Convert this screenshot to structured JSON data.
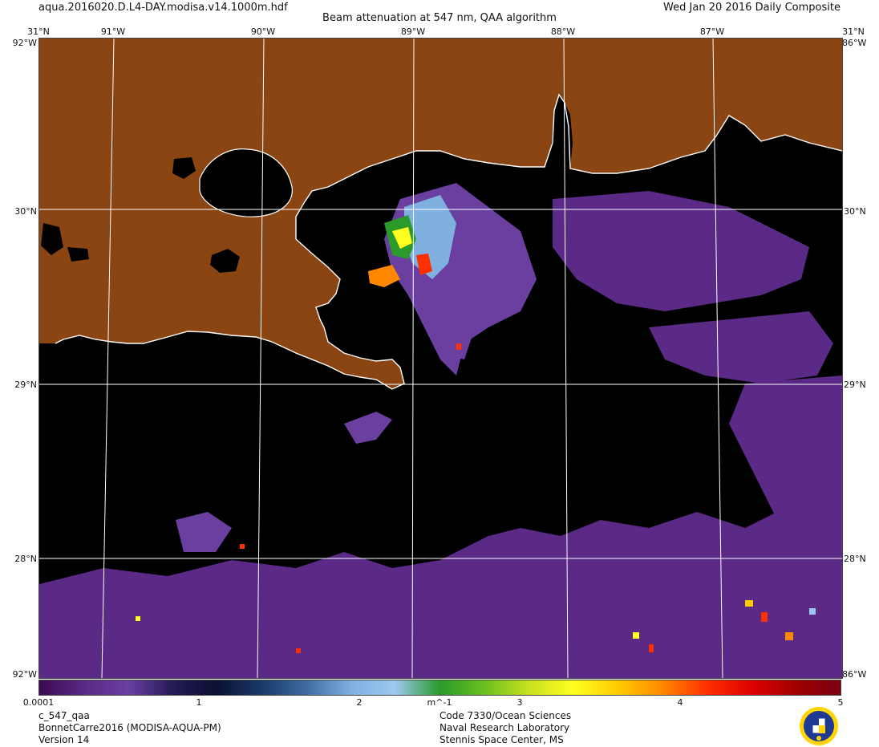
{
  "header": {
    "filename": "aqua.2016020.D.L4-DAY.modisa.v14.1000m.hdf",
    "title": "Beam attenuation at 547 nm, QAA algorithm",
    "date_label": "Wed Jan 20 2016 Daily Composite"
  },
  "map": {
    "top_longitude_labels": [
      "91°W",
      "90°W",
      "89°W",
      "88°W",
      "87°W"
    ],
    "latitude_labels": [
      "30°N",
      "29°N",
      "28°N"
    ],
    "corner_top_left": "31°N",
    "corner_top_right": "31°N",
    "corner_side_left_top": "92°W",
    "corner_side_right_top": "86°W",
    "corner_side_left_bottom": "92°W",
    "corner_side_right_bottom": "86°W",
    "land_color": "#8B4513",
    "water_nodata_color": "#000000",
    "coastline_color": "#ffffff",
    "graticule_color": "#ffffff"
  },
  "colorbar": {
    "min_label": "0.0001",
    "tick_labels": [
      "1",
      "2",
      "m^-1",
      "3",
      "4",
      "5"
    ],
    "unit": "m^-1",
    "colors": [
      "#3b0a52",
      "#5a2a86",
      "#6a3fa0",
      "#241a55",
      "#0a1030",
      "#1a3a6a",
      "#3f6aa0",
      "#7fb0e0",
      "#9cc8f0",
      "#2a9a2a",
      "#6ac020",
      "#c8e020",
      "#ffff20",
      "#ffcc00",
      "#ff8800",
      "#ff3000",
      "#e00000",
      "#a00000",
      "#7a0010"
    ]
  },
  "footer": {
    "left": [
      "c_547_qaa",
      "BonnetCarre2016 (MODISA-AQUA-PM)",
      "Version 14"
    ],
    "right": [
      "Code 7330/Ocean Sciences",
      "Naval Research Laboratory",
      "Stennis Space Center, MS"
    ]
  }
}
